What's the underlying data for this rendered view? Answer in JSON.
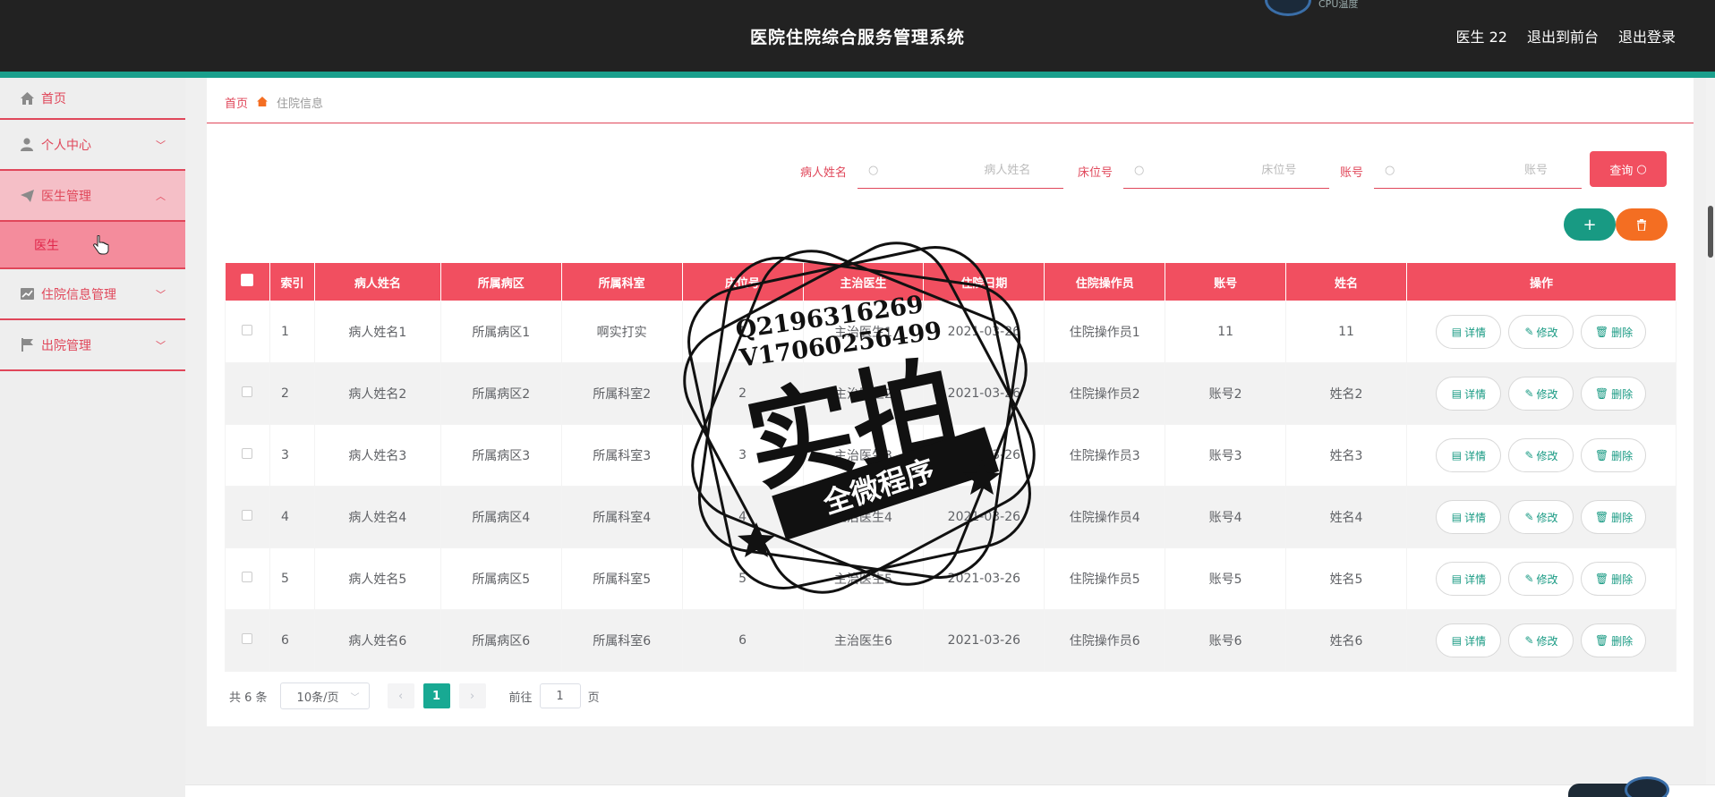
{
  "header": {
    "title": "医院住院综合服务管理系统",
    "user": "医生 22",
    "to_front": "退出到前台",
    "logout": "退出登录",
    "cpu_label": "CPU温度"
  },
  "sidebar": {
    "items": [
      {
        "label": "首页",
        "icon": "home-icon"
      },
      {
        "label": "个人中心",
        "icon": "user-icon"
      },
      {
        "label": "医生管理",
        "icon": "send-icon"
      },
      {
        "label": "医生",
        "icon": ""
      },
      {
        "label": "住院信息管理",
        "icon": "chart-icon"
      },
      {
        "label": "出院管理",
        "icon": "flag-icon"
      }
    ]
  },
  "breadcrumb": {
    "home": "首页",
    "current": "住院信息"
  },
  "search": {
    "patient_label": "病人姓名",
    "patient_placeholder": "病人姓名",
    "bed_label": "床位号",
    "bed_placeholder": "床位号",
    "account_label": "账号",
    "account_placeholder": "账号",
    "query_label": "查询"
  },
  "actions": {
    "add_label": "+",
    "delete_icon": "trash-icon"
  },
  "table": {
    "headers": [
      "索引",
      "病人姓名",
      "所属病区",
      "所属科室",
      "床位号",
      "主治医生",
      "住院日期",
      "住院操作员",
      "账号",
      "姓名",
      "操作"
    ],
    "rows": [
      [
        "1",
        "病人姓名1",
        "所属病区1",
        "啊实打实",
        "1",
        "主治医生1",
        "2021-03-26",
        "住院操作员1",
        "11",
        "11"
      ],
      [
        "2",
        "病人姓名2",
        "所属病区2",
        "所属科室2",
        "2",
        "主治医生2",
        "2021-03-26",
        "住院操作员2",
        "账号2",
        "姓名2"
      ],
      [
        "3",
        "病人姓名3",
        "所属病区3",
        "所属科室3",
        "3",
        "主治医生3",
        "2021-03-26",
        "住院操作员3",
        "账号3",
        "姓名3"
      ],
      [
        "4",
        "病人姓名4",
        "所属病区4",
        "所属科室4",
        "4",
        "主治医生4",
        "2021-03-26",
        "住院操作员4",
        "账号4",
        "姓名4"
      ],
      [
        "5",
        "病人姓名5",
        "所属病区5",
        "所属科室5",
        "5",
        "主治医生5",
        "2021-03-26",
        "住院操作员5",
        "账号5",
        "姓名5"
      ],
      [
        "6",
        "病人姓名6",
        "所属病区6",
        "所属科室6",
        "6",
        "主治医生6",
        "2021-03-26",
        "住院操作员6",
        "账号6",
        "姓名6"
      ]
    ],
    "ops": {
      "detail": "详情",
      "edit": "修改",
      "delete": "删除"
    }
  },
  "pager": {
    "total": "共 6 条",
    "page_size": "10条/页",
    "current_page": "1",
    "goto_prefix": "前往",
    "goto_value": "1",
    "goto_suffix": "页"
  },
  "watermark": {
    "qq": "Q2196316269",
    "v": "V17060256499",
    "big": "实拍",
    "banner": "全微程序"
  },
  "colors": {
    "accent": "#f14f60",
    "teal": "#189a83",
    "orange": "#f46e22",
    "topbar": "#222222"
  }
}
